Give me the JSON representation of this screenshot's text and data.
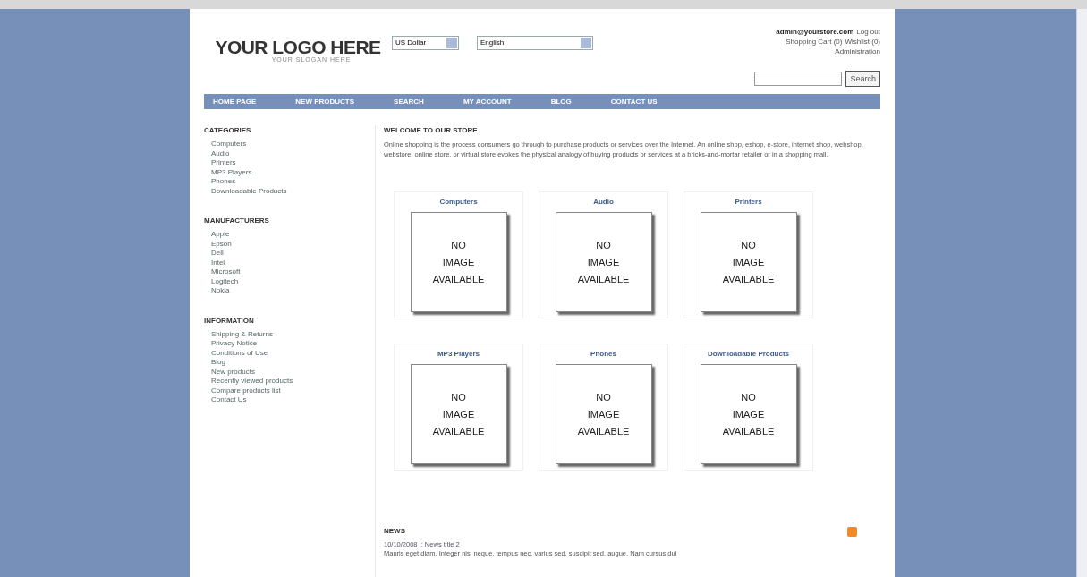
{
  "header": {
    "logo": "YOUR LOGO HERE",
    "slogan": "YOUR SLOGAN HERE",
    "currency": "US Dollar",
    "language": "English",
    "account_email": "admin@yourstore.com",
    "logout": "Log out",
    "shopping_cart": "Shopping Cart (0)",
    "wishlist": "Wishlist (0)",
    "administration": "Administration",
    "search_button": "Search"
  },
  "nav": [
    "HOME PAGE",
    "NEW PRODUCTS",
    "SEARCH",
    "MY ACCOUNT",
    "BLOG",
    "CONTACT US"
  ],
  "sidebar": [
    {
      "title": "CATEGORIES",
      "items": [
        "Computers",
        "Audio",
        "Printers",
        "MP3 Players",
        "Phones",
        "Downloadable Products"
      ]
    },
    {
      "title": "MANUFACTURERS",
      "items": [
        "Apple",
        "Epson",
        "Dell",
        "Intel",
        "Microsoft",
        "Logitech",
        "Nokia"
      ]
    },
    {
      "title": "INFORMATION",
      "items": [
        "Shipping & Returns",
        "Privacy Notice",
        "Conditions of Use",
        "Blog",
        "New products",
        "Recently viewed products",
        "Compare products list",
        "Contact Us"
      ]
    }
  ],
  "welcome": {
    "title": "WELCOME TO OUR STORE",
    "text": "Online shopping is the process consumers go through to purchase products or services over the Internet. An online shop, eshop, e-store, internet shop, webshop, webstore, online store, or virtual store evokes the physical analogy of buying products or services at a bricks-and-mortar retailer or in a shopping mall."
  },
  "categories": [
    {
      "name": "Computers",
      "image_text": [
        "NO",
        "IMAGE",
        "AVAILABLE"
      ]
    },
    {
      "name": "Audio",
      "image_text": [
        "NO",
        "IMAGE",
        "AVAILABLE"
      ]
    },
    {
      "name": "Printers",
      "image_text": [
        "NO",
        "IMAGE",
        "AVAILABLE"
      ]
    },
    {
      "name": "MP3 Players",
      "image_text": [
        "NO",
        "IMAGE",
        "AVAILABLE"
      ]
    },
    {
      "name": "Phones",
      "image_text": [
        "NO",
        "IMAGE",
        "AVAILABLE"
      ]
    },
    {
      "name": "Downloadable Products",
      "image_text": [
        "NO",
        "IMAGE",
        "AVAILABLE"
      ]
    }
  ],
  "news": {
    "title": "NEWS",
    "items": [
      {
        "date_title": "10/10/2008 :: News title 2",
        "text": "Mauris eget diam. Integer nisl neque, tempus nec, varius sed, suscipit sed, augue. Nam cursus dui"
      }
    ]
  }
}
